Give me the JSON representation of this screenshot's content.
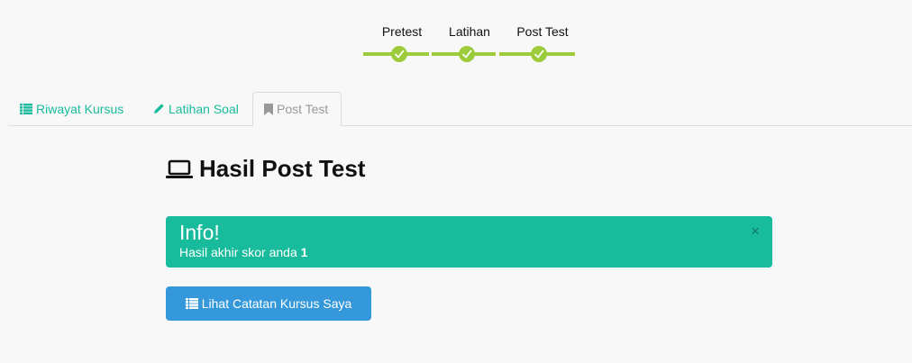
{
  "stepper": {
    "steps": [
      {
        "label": "Pretest",
        "completed": true
      },
      {
        "label": "Latihan",
        "completed": true
      },
      {
        "label": "Post Test",
        "completed": true
      }
    ],
    "color": "#9ccc3c"
  },
  "tabs": [
    {
      "label": "Riwayat Kursus",
      "icon": "list-icon",
      "active": false
    },
    {
      "label": "Latihan Soal",
      "icon": "pencil-icon",
      "active": false
    },
    {
      "label": "Post Test",
      "icon": "bookmark-icon",
      "active": true
    }
  ],
  "page": {
    "title": "Hasil Post Test",
    "title_icon": "laptop-icon"
  },
  "alert": {
    "title": "Info!",
    "message": "Hasil akhir skor anda ",
    "score": "1",
    "close_symbol": "×",
    "color": "#18bc9c"
  },
  "action_button": {
    "label": "Lihat Catatan Kursus Saya",
    "icon": "list-icon",
    "color": "#3498db"
  }
}
